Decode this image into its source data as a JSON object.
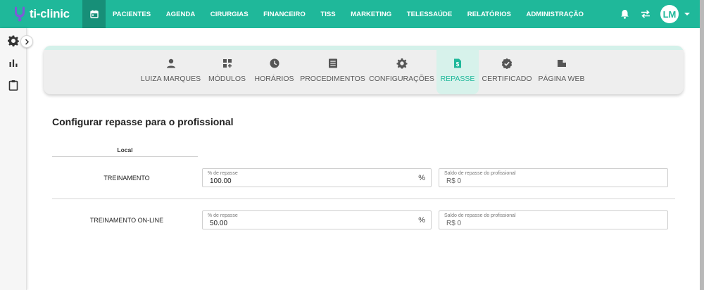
{
  "app": {
    "logo_text": "ti-clinic"
  },
  "nav": {
    "items": [
      "PACIENTES",
      "AGENDA",
      "CIRURGIAS",
      "FINANCEIRO",
      "TISS",
      "MARKETING",
      "TELESSAÚDE",
      "RELATÓRIOS",
      "ADMINISTRAÇÃO"
    ]
  },
  "user": {
    "initials": "LM"
  },
  "tabs": [
    {
      "label": "LUIZA MARQUES",
      "icon": "person-icon"
    },
    {
      "label": "MÓDULOS",
      "icon": "modules-icon"
    },
    {
      "label": "HORÁRIOS",
      "icon": "clock-icon"
    },
    {
      "label": "PROCEDIMENTOS",
      "icon": "list-icon"
    },
    {
      "label": "CONFIGURAÇÕES",
      "icon": "gear-icon"
    },
    {
      "label": "REPASSE",
      "icon": "money-icon",
      "active": true
    },
    {
      "label": "CERTIFICADO",
      "icon": "verified-icon"
    },
    {
      "label": "PÁGINA WEB",
      "icon": "folder-icon"
    }
  ],
  "page": {
    "title": "Configurar repasse para o profissional",
    "column_header": "Local"
  },
  "rows": [
    {
      "local": "TREINAMENTO",
      "percent_label": "% de repasse",
      "percent_value": "100.00",
      "percent_suffix": "%",
      "saldo_label": "Saldo de repasse do profissional",
      "saldo_value": "R$ 0"
    },
    {
      "local": "TREINAMENTO ON-LINE",
      "percent_label": "% de repasse",
      "percent_value": "50.00",
      "percent_suffix": "%",
      "saldo_label": "Saldo de repasse do profissional",
      "saldo_value": "R$ 0"
    }
  ],
  "colors": {
    "brand": "#1fb89a",
    "brand_dark": "#178f78",
    "active_tab_bg": "#d7f2eb"
  }
}
